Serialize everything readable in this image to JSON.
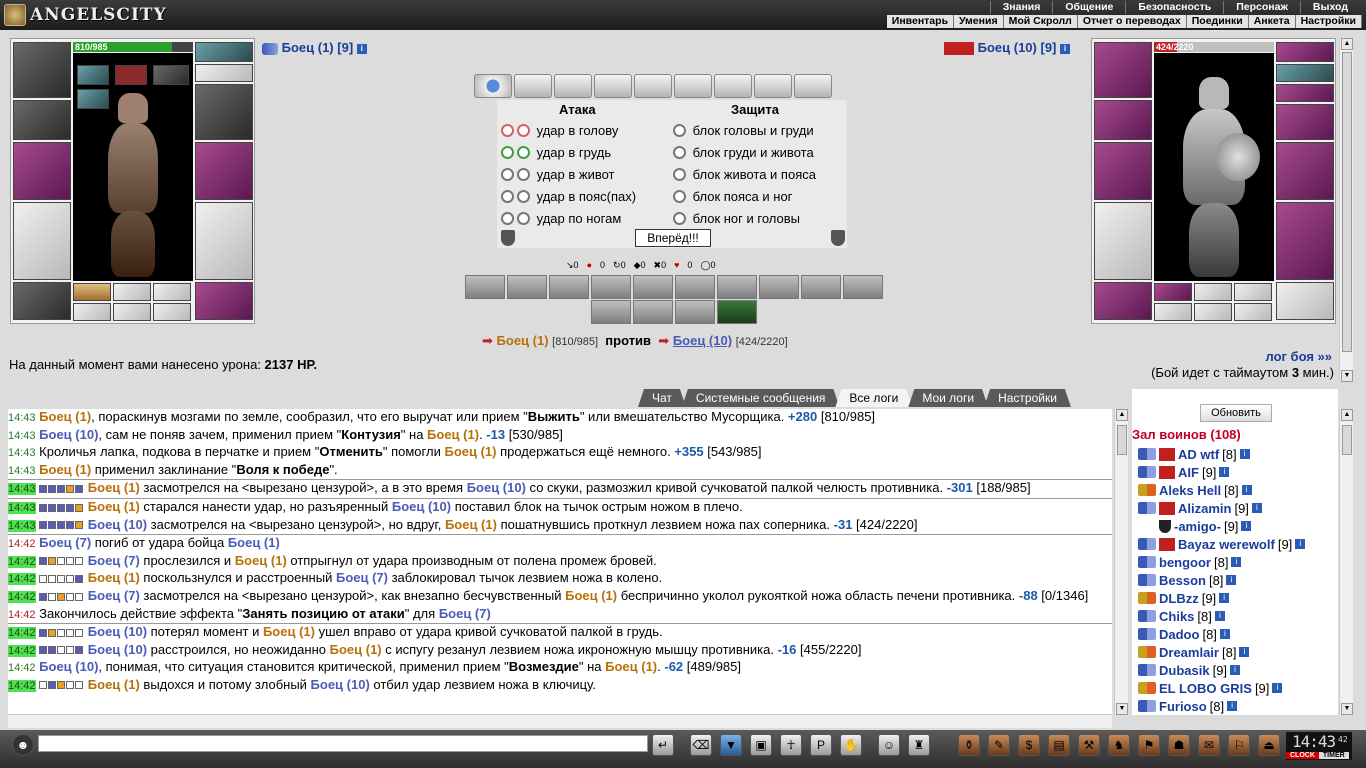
{
  "top": {
    "logo": "ANGELSCITY",
    "menu_main": [
      "Знания",
      "Общение",
      "Безопасность",
      "Персонаж",
      "Выход"
    ],
    "menu_sub": [
      "Инвентарь",
      "Умения",
      "Мой Скролл",
      "Отчет о переводах",
      "Поединки",
      "Анкета",
      "Настройки"
    ]
  },
  "left_player": {
    "hp": "810/985",
    "hp_fraction": 0.822,
    "label": "Боец (1)",
    "level": "[9]"
  },
  "right_player": {
    "hp": "424/2220",
    "hp_fraction": 0.191,
    "label": "Боец (10)",
    "level": "[9]"
  },
  "fight": {
    "attack_header": "Атака",
    "defense_header": "Защита",
    "attacks": [
      "удар в голову",
      "удар в грудь",
      "удар в живот",
      "удар в пояс(пах)",
      "удар по ногам"
    ],
    "blocks": [
      "блок головы и груди",
      "блок груди и живота",
      "блок живота и пояса",
      "блок пояса и ног",
      "блок ног и головы"
    ],
    "go_button": "Вперёд!!!",
    "mini_stats": [
      "0",
      "0",
      "0",
      "0",
      "0",
      "0",
      "0"
    ]
  },
  "vs": {
    "p1": "Боец (1)",
    "p1_hp": "[810/985]",
    "word": "против",
    "p2": "Боец (10)",
    "p2_hp": "[424/2220]"
  },
  "damage": {
    "prefix": "На данный момент вами нанесено урона:",
    "value": "2137 HP."
  },
  "battle_log_link": "лог боя »»",
  "timeout": {
    "before": "(Бой идет с таймаутом",
    "value": "3",
    "after": "мин.)"
  },
  "log_tabs": [
    "Чат",
    "Системные сообщения",
    "Все логи",
    "Мои логи",
    "Настройки"
  ],
  "log": [
    {
      "t": "14:43",
      "parts": [
        [
          "n1",
          "Боец (1)"
        ],
        [
          "x",
          ", пораскинув мозгами по земле, сообразил, что его выручат или прием \""
        ],
        [
          "b",
          "Выжить"
        ],
        [
          "x",
          "\" или вмешательство Мусорщика. "
        ],
        [
          "num",
          "+280"
        ],
        [
          "x",
          " [810/985]"
        ]
      ]
    },
    {
      "t": "14:43",
      "parts": [
        [
          "n2",
          "Боец (10)"
        ],
        [
          "x",
          ", сам не поняв зачем, применил прием \""
        ],
        [
          "b",
          "Контузия"
        ],
        [
          "x",
          "\" на "
        ],
        [
          "n1",
          "Боец (1)"
        ],
        [
          "x",
          ". "
        ],
        [
          "num",
          "-13"
        ],
        [
          "x",
          " [530/985]"
        ]
      ]
    },
    {
      "t": "14:43",
      "parts": [
        [
          "x",
          "Кроличья лапка, подкова в перчатке и прием \""
        ],
        [
          "b",
          "Отменить"
        ],
        [
          "x",
          "\" помогли "
        ],
        [
          "n1",
          "Боец (1)"
        ],
        [
          "x",
          " продержаться ещё немного. "
        ],
        [
          "num",
          "+355"
        ],
        [
          "x",
          " [543/985]"
        ]
      ]
    },
    {
      "t": "14:43",
      "parts": [
        [
          "n1",
          "Боец (1)"
        ],
        [
          "x",
          " применил заклинание \""
        ],
        [
          "b",
          "Воля к победе"
        ],
        [
          "x",
          "\"."
        ]
      ]
    },
    {
      "t": "14:43",
      "hl": true,
      "sep": true,
      "wrap": true,
      "boxes": "fffof",
      "parts": [
        [
          "n1",
          "Боец (1)"
        ],
        [
          "x",
          " засмотрелся на <вырезано цензурой>, а в это время "
        ],
        [
          "n2",
          "Боец (10)"
        ],
        [
          "x",
          " со скуки, размозжил кривой сучковатой палкой челюсть противника. "
        ],
        [
          "num",
          "-301"
        ],
        [
          "x",
          " [188/985]"
        ]
      ]
    },
    {
      "t": "14:43",
      "hl": true,
      "sep": true,
      "boxes": "ffffo",
      "parts": [
        [
          "n1",
          "Боец (1)"
        ],
        [
          "x",
          " старался нанести удар, но разъяренный "
        ],
        [
          "n2",
          "Боец (10)"
        ],
        [
          "x",
          " поставил блок на тычок острым ножом в плечо."
        ]
      ]
    },
    {
      "t": "14:43",
      "hl": true,
      "boxes": "ffffo",
      "parts": [
        [
          "n2",
          "Боец (10)"
        ],
        [
          "x",
          " засмотрелся на <вырезано цензурой>, но вдруг, "
        ],
        [
          "n1",
          "Боец (1)"
        ],
        [
          "x",
          " пошатнувшись проткнул лезвием ножа пах соперника. "
        ],
        [
          "num",
          "-31"
        ],
        [
          "x",
          " [424/2220]"
        ]
      ]
    },
    {
      "t": "14:42",
      "red": true,
      "sep": true,
      "parts": [
        [
          "n2",
          "Боец (7)"
        ],
        [
          "x",
          " погиб от удара бойца "
        ],
        [
          "n2",
          "Боец (1)"
        ]
      ]
    },
    {
      "t": "14:42",
      "hl": true,
      "boxes": "foeee",
      "parts": [
        [
          "n2",
          "Боец (7)"
        ],
        [
          "x",
          " прослезился и "
        ],
        [
          "n1",
          "Боец (1)"
        ],
        [
          "x",
          " отпрыгнул от удара производным от полена промеж бровей."
        ]
      ]
    },
    {
      "t": "14:42",
      "hl": true,
      "boxes": "eeeef",
      "parts": [
        [
          "n1",
          "Боец (1)"
        ],
        [
          "x",
          " поскользнулся и расстроенный "
        ],
        [
          "n2",
          "Боец (7)"
        ],
        [
          "x",
          " заблокировал тычок лезвием ножа в колено."
        ]
      ]
    },
    {
      "t": "14:42",
      "hl": true,
      "wrap": true,
      "boxes": "feoee",
      "parts": [
        [
          "n2",
          "Боец (7)"
        ],
        [
          "x",
          " засмотрелся на <вырезано цензурой>, как внезапно бесчувственный "
        ],
        [
          "n1",
          "Боец (1)"
        ],
        [
          "x",
          " беспричинно уколол рукояткой ножа область печени противника. "
        ],
        [
          "num",
          "-88"
        ],
        [
          "x",
          " [0/1346]"
        ]
      ]
    },
    {
      "t": "14:42",
      "red": true,
      "parts": [
        [
          "x",
          "Закончилось действие эффекта \""
        ],
        [
          "b",
          "Занять позицию от атаки"
        ],
        [
          "x",
          "\" для "
        ],
        [
          "n2",
          "Боец (7)"
        ]
      ]
    },
    {
      "t": "14:42",
      "hl": true,
      "sep": true,
      "boxes": "foeee",
      "parts": [
        [
          "n2",
          "Боец (10)"
        ],
        [
          "x",
          " потерял момент и "
        ],
        [
          "n1",
          "Боец (1)"
        ],
        [
          "x",
          " ушел вправо от удара кривой сучковатой палкой в грудь."
        ]
      ]
    },
    {
      "t": "14:42",
      "hl": true,
      "boxes": "ffeef",
      "parts": [
        [
          "n2",
          "Боец (10)"
        ],
        [
          "x",
          " расстроился, но неожиданно "
        ],
        [
          "n1",
          "Боец (1)"
        ],
        [
          "x",
          " с испугу резанул лезвием ножа икроножную мышцу противника. "
        ],
        [
          "num",
          "-16"
        ],
        [
          "x",
          " [455/2220]"
        ]
      ]
    },
    {
      "t": "14:42",
      "parts": [
        [
          "n2",
          "Боец (10)"
        ],
        [
          "x",
          ", понимая, что ситуация становится критической, применил прием \""
        ],
        [
          "b",
          "Возмездие"
        ],
        [
          "x",
          "\" на "
        ],
        [
          "n1",
          "Боец (1)"
        ],
        [
          "x",
          ". "
        ],
        [
          "num",
          "-62"
        ],
        [
          "x",
          " [489/985]"
        ]
      ]
    },
    {
      "t": "14:42",
      "hl": true,
      "boxes": "efoee",
      "parts": [
        [
          "n1",
          "Боец (1)"
        ],
        [
          "x",
          " выдохся и потому злобный "
        ],
        [
          "n2",
          "Боец (10)"
        ],
        [
          "x",
          " отбил удар лезвием ножа в ключицу."
        ]
      ]
    }
  ],
  "side": {
    "refresh": "Обновить",
    "hall_title": "Зал воинов (108)",
    "players": [
      {
        "name": "AD wtf",
        "level": "[8]",
        "clan": "red",
        "icon": "blue"
      },
      {
        "name": "AIF",
        "level": "[9]",
        "clan": "red",
        "icon": "blue"
      },
      {
        "name": "Aleks Hell",
        "level": "[8]",
        "icon": "yellow"
      },
      {
        "name": "Alizamin",
        "level": "[9]",
        "clan": "red",
        "icon": "blue"
      },
      {
        "name": "-amigo-",
        "level": "[9]",
        "clan": "k",
        "icon": "none"
      },
      {
        "name": "Bayaz werewolf",
        "level": "[9]",
        "clan": "red",
        "icon": "blue"
      },
      {
        "name": "bengoor",
        "level": "[8]",
        "icon": "blue"
      },
      {
        "name": "Besson",
        "level": "[8]",
        "icon": "blue"
      },
      {
        "name": "DLBzz",
        "level": "[9]",
        "icon": "yellow"
      },
      {
        "name": "Chiks",
        "level": "[8]",
        "icon": "blue"
      },
      {
        "name": "Dadoo",
        "level": "[8]",
        "icon": "blue"
      },
      {
        "name": "Dreamlair",
        "level": "[8]",
        "icon": "yellow"
      },
      {
        "name": "Dubasik",
        "level": "[9]",
        "icon": "blue"
      },
      {
        "name": "EL LOBO GRIS",
        "level": "[9]",
        "icon": "yellow"
      },
      {
        "name": "Furioso",
        "level": "[8]",
        "icon": "blue"
      }
    ]
  },
  "clock": {
    "time": "14:43",
    "seconds": "42",
    "label_left": "CLOCK",
    "label_right": "TIMER"
  },
  "info_icon": "i"
}
